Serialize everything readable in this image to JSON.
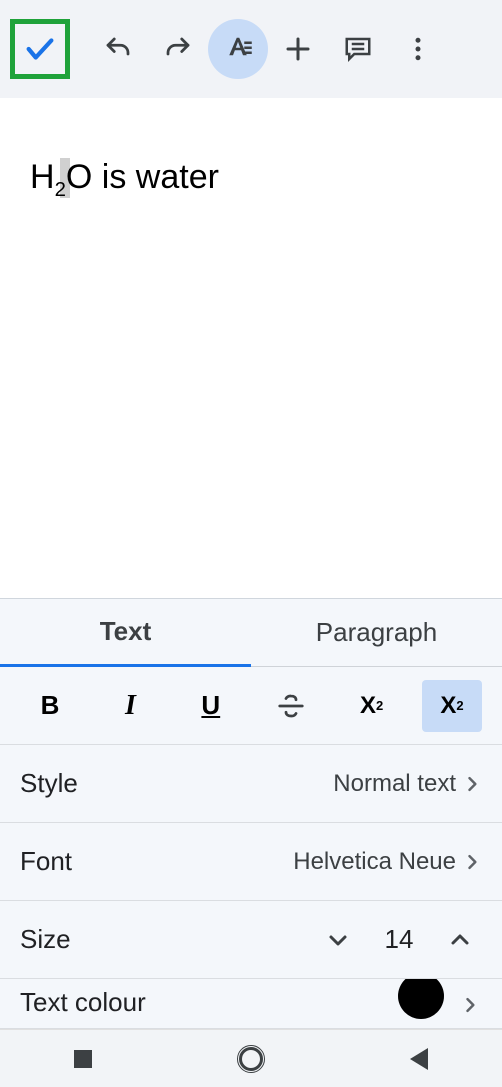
{
  "toolbar": {
    "confirm": "check",
    "undo": "undo",
    "redo": "redo",
    "format": "text-format",
    "insert": "plus",
    "comment": "comment",
    "more": "more"
  },
  "document": {
    "content_pre": "H",
    "content_sub": "2",
    "content_post": "O is water"
  },
  "panel": {
    "tabs": {
      "text": "Text",
      "paragraph": "Paragraph"
    },
    "buttons": {
      "bold": "B",
      "italic": "I",
      "underline": "U",
      "strikethrough": "S",
      "superscript": "X",
      "superscript_sup": "2",
      "subscript": "X",
      "subscript_sub": "2"
    },
    "style": {
      "label": "Style",
      "value": "Normal text"
    },
    "font": {
      "label": "Font",
      "value": "Helvetica Neue"
    },
    "size": {
      "label": "Size",
      "value": "14"
    },
    "text_colour": {
      "label": "Text colour",
      "value_hex": "#000000"
    }
  }
}
